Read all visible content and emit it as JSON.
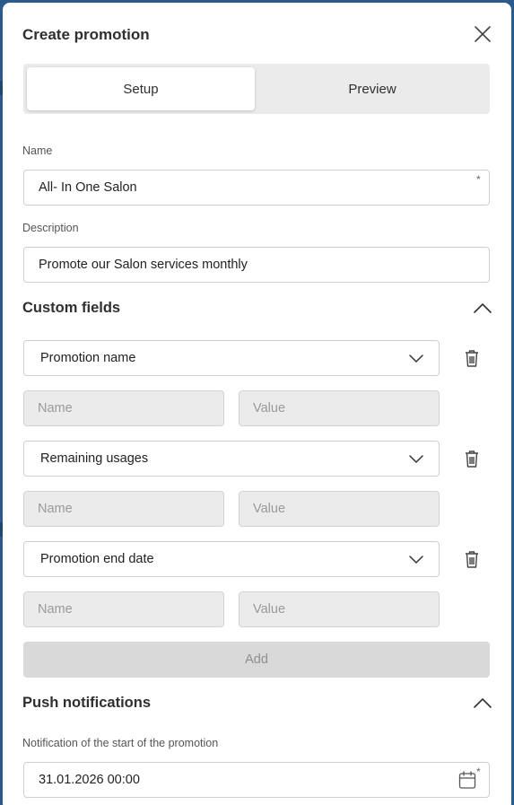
{
  "modal": {
    "title": "Create promotion",
    "close_icon": "close-icon"
  },
  "tabs": [
    {
      "label": "Setup",
      "active": true
    },
    {
      "label": "Preview",
      "active": false
    }
  ],
  "name_field": {
    "label": "Name",
    "value": "All- In One Salon",
    "required_mark": "*"
  },
  "description_field": {
    "label": "Description",
    "value": "Promote our Salon services monthly"
  },
  "custom_fields": {
    "title": "Custom fields",
    "collapse_icon": "chevron-up-icon",
    "items": [
      {
        "select_value": "Promotion name",
        "name_placeholder": "Name",
        "value_placeholder": "Value"
      },
      {
        "select_value": "Remaining usages",
        "name_placeholder": "Name",
        "value_placeholder": "Value"
      },
      {
        "select_value": "Promotion end date",
        "name_placeholder": "Name",
        "value_placeholder": "Value"
      }
    ],
    "add_label": "Add",
    "delete_icon": "trash-icon"
  },
  "push_notifications": {
    "title": "Push notifications",
    "collapse_icon": "chevron-up-icon",
    "start_label": "Notification of the start of the promotion",
    "start_value": "31.01.2026 00:00",
    "calendar_icon": "calendar-icon",
    "required_mark": "*"
  },
  "colors": {
    "backdrop": "#2a5b8c",
    "surface": "#ffffff",
    "segment_bg": "#ebebeb",
    "disabled_bg": "#ebebeb",
    "add_button_bg": "#d9d9d9"
  }
}
